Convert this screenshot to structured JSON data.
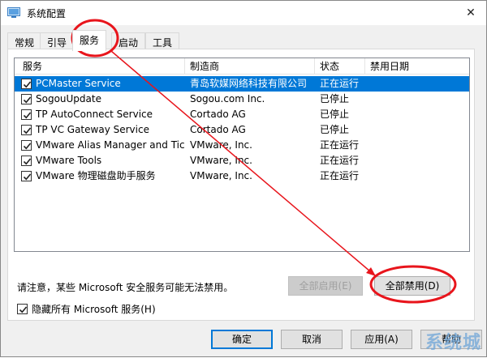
{
  "window": {
    "title": "系统配置",
    "close_glyph": "✕"
  },
  "tabs": [
    {
      "label": "常规"
    },
    {
      "label": "引导"
    },
    {
      "label": "服务"
    },
    {
      "label": "启动"
    },
    {
      "label": "工具"
    }
  ],
  "active_tab": "服务",
  "columns": [
    "服务",
    "制造商",
    "状态",
    "禁用日期"
  ],
  "services": [
    {
      "name": "PCMaster Service",
      "maker": "青岛软媒网络科技有限公司",
      "status": "正在运行",
      "disabled_date": "",
      "checked": true,
      "selected": true
    },
    {
      "name": "SogouUpdate",
      "maker": "Sogou.com Inc.",
      "status": "已停止",
      "disabled_date": "",
      "checked": true,
      "selected": false
    },
    {
      "name": "TP AutoConnect Service",
      "maker": "Cortado AG",
      "status": "已停止",
      "disabled_date": "",
      "checked": true,
      "selected": false
    },
    {
      "name": "TP VC Gateway Service",
      "maker": "Cortado AG",
      "status": "已停止",
      "disabled_date": "",
      "checked": true,
      "selected": false
    },
    {
      "name": "VMware Alias Manager and Tick...",
      "maker": "VMware, Inc.",
      "status": "正在运行",
      "disabled_date": "",
      "checked": true,
      "selected": false
    },
    {
      "name": "VMware Tools",
      "maker": "VMware, Inc.",
      "status": "正在运行",
      "disabled_date": "",
      "checked": true,
      "selected": false
    },
    {
      "name": "VMware 物理磁盘助手服务",
      "maker": "VMware, Inc.",
      "status": "正在运行",
      "disabled_date": "",
      "checked": true,
      "selected": false
    }
  ],
  "note": "请注意，某些 Microsoft 安全服务可能无法禁用。",
  "enable_all_label": "全部启用(E)",
  "disable_all_label": "全部禁用(D)",
  "hide_ms_label": "隐藏所有 Microsoft 服务(H)",
  "hide_ms_checked": true,
  "footer": {
    "ok": "确定",
    "cancel": "取消",
    "apply": "应用(A)",
    "help": "帮助"
  },
  "watermark": "系统城",
  "colors": {
    "selection": "#0078d7",
    "annotation": "#e8151c"
  },
  "icons": {
    "app": "system-config-icon",
    "close": "close-icon",
    "checkbox": "checkbox-checked-icon"
  }
}
